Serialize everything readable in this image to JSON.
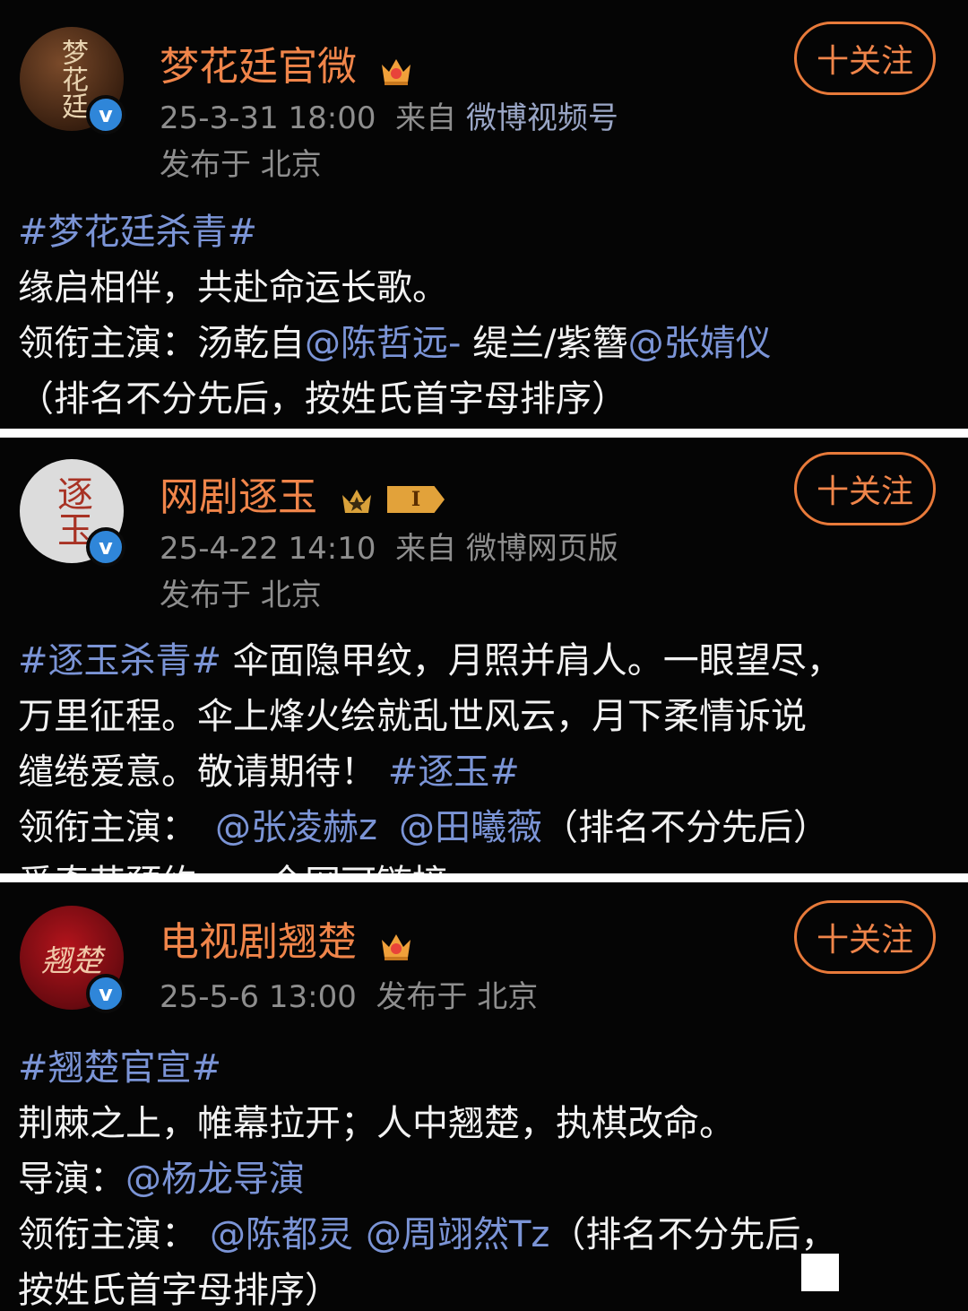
{
  "follow_label": "十关注",
  "posts": [
    {
      "avatar_text": "梦花廷",
      "name": "梦花廷官微",
      "date": "25-3-31 18:00",
      "from_label": "来自",
      "source": "微博视频号",
      "location": "发布于 北京",
      "lines": [
        {
          "hashtag": "#梦花廷杀青#"
        },
        {
          "text": "缘启相伴，共赴命运长歌。"
        },
        {
          "t1": "领衔主演：汤乾自",
          "m1": "@陈哲远-",
          "t2": " 缇兰/紫簪",
          "m2": "@张婧仪"
        },
        {
          "text": "（排名不分先后，按姓氏首字母排序）"
        }
      ]
    },
    {
      "avatar_text": "逐玉",
      "name": "网剧逐玉",
      "level_badge": "I",
      "date": "25-4-22 14:10",
      "from_label": "来自",
      "source": "微博网页版",
      "location": "发布于 北京",
      "lines": [
        {
          "hashtag": "#逐玉杀青#",
          "text": " 伞面隐甲纹，月照并肩人。一眼望尽，"
        },
        {
          "text": "万里征程。伞上烽火绘就乱世风云，月下柔情诉说"
        },
        {
          "text": "缱绻爱意。敬请期待！",
          "hashtag_end": "#逐玉#"
        },
        {
          "t1": "领衔主演：",
          "m1": "@张凌赫z",
          "m2": "@田曦薇",
          "t2": "（排名不分先后）"
        },
        {
          "text": "爱奇艺预约一一全网可链接"
        }
      ]
    },
    {
      "avatar_text": "翘楚",
      "name": "电视剧翘楚",
      "date": "25-5-6 13:00",
      "location": "发布于 北京",
      "lines": [
        {
          "hashtag": "#翘楚官宣#"
        },
        {
          "text": "荆棘之上，帷幕拉开；人中翘楚，执棋改命。"
        },
        {
          "t1": "导演：",
          "m1": "@杨龙导演"
        },
        {
          "t1": "领衔主演：",
          "m1": "@陈都灵",
          "m2": "@周翊然Tz",
          "t2": "（排名不分先后，"
        },
        {
          "text": "按姓氏首字母排序）"
        }
      ]
    }
  ]
}
